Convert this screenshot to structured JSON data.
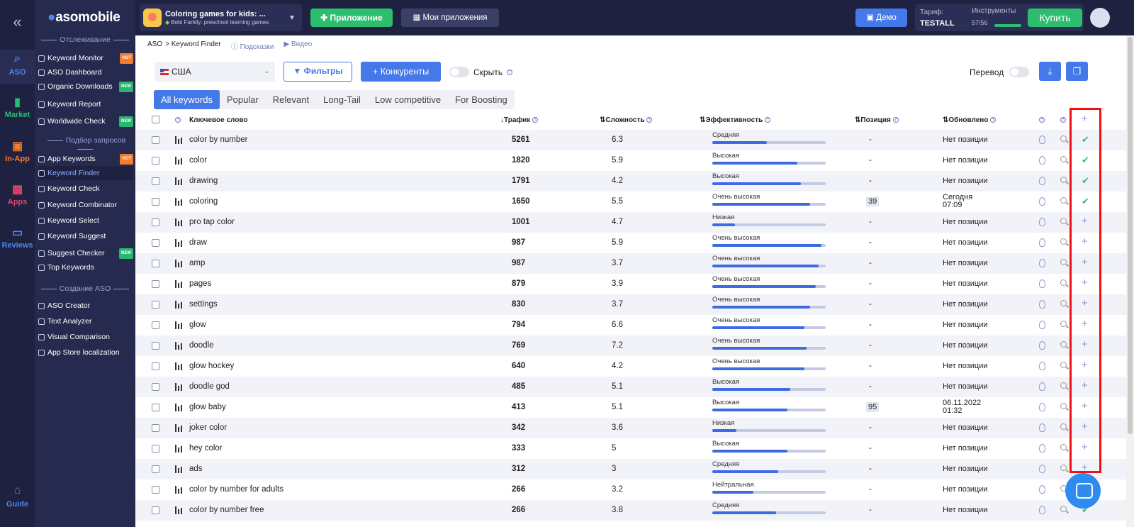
{
  "brand": {
    "name_a": "asomobile",
    "name_b": ""
  },
  "rail": [
    {
      "label": "ASO",
      "color": "#4e86f6",
      "icon": "search-icon"
    },
    {
      "label": "Market",
      "color": "#2dbd6e",
      "icon": "chart-icon"
    },
    {
      "label": "In-App",
      "color": "#f47c2d",
      "icon": "bag-icon"
    },
    {
      "label": "Apps",
      "color": "#e0456a",
      "icon": "grid-icon"
    },
    {
      "label": "Reviews",
      "color": "#4e86f6",
      "icon": "comment-icon"
    },
    {
      "label": "Guide",
      "color": "#4e86f6",
      "icon": "cap-icon"
    }
  ],
  "sidebar": {
    "section1": "Отслеживание",
    "section2": "Подбор запросов",
    "section3": "Создание ASO",
    "items1": [
      {
        "label": "Keyword Monitor",
        "badge": "HOT"
      },
      {
        "label": "ASO Dashboard",
        "badge": ""
      },
      {
        "label": "Organic Downloads",
        "badge": "NEW"
      },
      {
        "label": "Keyword Report",
        "badge": ""
      },
      {
        "label": "Worldwide Check",
        "badge": "NEW"
      }
    ],
    "items2": [
      {
        "label": "App Keywords",
        "badge": "HOT"
      },
      {
        "label": "Keyword Finder",
        "badge": ""
      },
      {
        "label": "Keyword Check",
        "badge": ""
      },
      {
        "label": "Keyword Combinator",
        "badge": ""
      },
      {
        "label": "Keyword Select",
        "badge": ""
      },
      {
        "label": "Keyword Suggest",
        "badge": ""
      },
      {
        "label": "Suggest Checker",
        "badge": "NEW"
      },
      {
        "label": "Top Keywords",
        "badge": ""
      }
    ],
    "items3": [
      {
        "label": "ASO Creator"
      },
      {
        "label": "Text Analyzer"
      },
      {
        "label": "Visual Comparison"
      },
      {
        "label": "App Store localization"
      }
    ]
  },
  "topbar": {
    "app_title": "Coloring games for kids: ...",
    "app_sub": "Bebi Family: preschool learning games",
    "add_app": "Приложение",
    "my_apps": "Мои приложения",
    "demo": "Демо",
    "tarif_label": "Тариф:",
    "tarif_value": "TESTALL",
    "tools_label": "Инструменты",
    "tools_value": "57/56",
    "buy": "Купить"
  },
  "breadcrumb": {
    "root": "ASO",
    "current": "> Keyword Finder",
    "hints": "Подсказки",
    "video": "Видео"
  },
  "controls": {
    "country": "США",
    "filters": "Фильтры",
    "competitors": "Конкуренты",
    "hide": "Скрыть",
    "translate": "Перевод"
  },
  "tabs": [
    "All keywords",
    "Popular",
    "Relevant",
    "Long-Tail",
    "Low competitive",
    "For Boosting"
  ],
  "columns": {
    "keyword": "Ключевое слово",
    "traffic": "Трафик",
    "difficulty": "Сложность",
    "efficiency": "Эффективность",
    "position": "Позиция",
    "updated": "Обновлено"
  },
  "rows": [
    {
      "kw": "color by number",
      "traffic": "5261",
      "diff": "6.3",
      "eff": "Средняя",
      "eff_pct": 0.48,
      "pos": "-",
      "upd1": "Нет позиции",
      "upd2": "",
      "added": true
    },
    {
      "kw": "color",
      "traffic": "1820",
      "diff": "5.9",
      "eff": "Высокая",
      "eff_pct": 0.75,
      "pos": "-",
      "upd1": "Нет позиции",
      "upd2": "",
      "added": true
    },
    {
      "kw": "drawing",
      "traffic": "1791",
      "diff": "4.2",
      "eff": "Высокая",
      "eff_pct": 0.78,
      "pos": "-",
      "upd1": "Нет позиции",
      "upd2": "",
      "added": true
    },
    {
      "kw": "coloring",
      "traffic": "1650",
      "diff": "5.5",
      "eff": "Очень высокая",
      "eff_pct": 0.86,
      "pos": "39",
      "upd1": "Сегодня",
      "upd2": "07:09",
      "added": true
    },
    {
      "kw": "pro tap color",
      "traffic": "1001",
      "diff": "4.7",
      "eff": "Низкая",
      "eff_pct": 0.2,
      "pos": "-",
      "upd1": "Нет позиции",
      "upd2": "",
      "added": false
    },
    {
      "kw": "draw",
      "traffic": "987",
      "diff": "5.9",
      "eff": "Очень высокая",
      "eff_pct": 0.96,
      "pos": "-",
      "upd1": "Нет позиции",
      "upd2": "",
      "added": false
    },
    {
      "kw": "amp",
      "traffic": "987",
      "diff": "3.7",
      "eff": "Очень высокая",
      "eff_pct": 0.94,
      "pos": "-",
      "upd1": "Нет позиции",
      "upd2": "",
      "added": false
    },
    {
      "kw": "pages",
      "traffic": "879",
      "diff": "3.9",
      "eff": "Очень высокая",
      "eff_pct": 0.91,
      "pos": "-",
      "upd1": "Нет позиции",
      "upd2": "",
      "added": false
    },
    {
      "kw": "settings",
      "traffic": "830",
      "diff": "3.7",
      "eff": "Очень высокая",
      "eff_pct": 0.86,
      "pos": "-",
      "upd1": "Нет позиции",
      "upd2": "",
      "added": false
    },
    {
      "kw": "glow",
      "traffic": "794",
      "diff": "6.6",
      "eff": "Очень высокая",
      "eff_pct": 0.81,
      "pos": "-",
      "upd1": "Нет позиции",
      "upd2": "",
      "added": false
    },
    {
      "kw": "doodle",
      "traffic": "769",
      "diff": "7.2",
      "eff": "Очень высокая",
      "eff_pct": 0.83,
      "pos": "-",
      "upd1": "Нет позиции",
      "upd2": "",
      "added": false
    },
    {
      "kw": "glow hockey",
      "traffic": "640",
      "diff": "4.2",
      "eff": "Очень высокая",
      "eff_pct": 0.81,
      "pos": "-",
      "upd1": "Нет позиции",
      "upd2": "",
      "added": false
    },
    {
      "kw": "doodle god",
      "traffic": "485",
      "diff": "5.1",
      "eff": "Высокая",
      "eff_pct": 0.69,
      "pos": "-",
      "upd1": "Нет позиции",
      "upd2": "",
      "added": false
    },
    {
      "kw": "glow baby",
      "traffic": "413",
      "diff": "5.1",
      "eff": "Высокая",
      "eff_pct": 0.66,
      "pos": "95",
      "upd1": "06.11.2022",
      "upd2": "01:32",
      "added": false
    },
    {
      "kw": "joker color",
      "traffic": "342",
      "diff": "3.6",
      "eff": "Низкая",
      "eff_pct": 0.21,
      "pos": "-",
      "upd1": "Нет позиции",
      "upd2": "",
      "added": false
    },
    {
      "kw": "hey color",
      "traffic": "333",
      "diff": "5",
      "eff": "Высокая",
      "eff_pct": 0.66,
      "pos": "-",
      "upd1": "Нет позиции",
      "upd2": "",
      "added": false
    },
    {
      "kw": "ads",
      "traffic": "312",
      "diff": "3",
      "eff": "Средняя",
      "eff_pct": 0.58,
      "pos": "-",
      "upd1": "Нет позиции",
      "upd2": "",
      "added": false
    },
    {
      "kw": "color by number for adults",
      "traffic": "266",
      "diff": "3.2",
      "eff": "Нейтральная",
      "eff_pct": 0.36,
      "pos": "-",
      "upd1": "Нет позиции",
      "upd2": "",
      "added": false
    },
    {
      "kw": "color by number free",
      "traffic": "266",
      "diff": "3.8",
      "eff": "Средняя",
      "eff_pct": 0.56,
      "pos": "-",
      "upd1": "Нет позиции",
      "upd2": "",
      "added": true
    }
  ],
  "colors": {
    "accent": "#4578e8",
    "green": "#2dbd6e",
    "highlight": "#e11111"
  }
}
